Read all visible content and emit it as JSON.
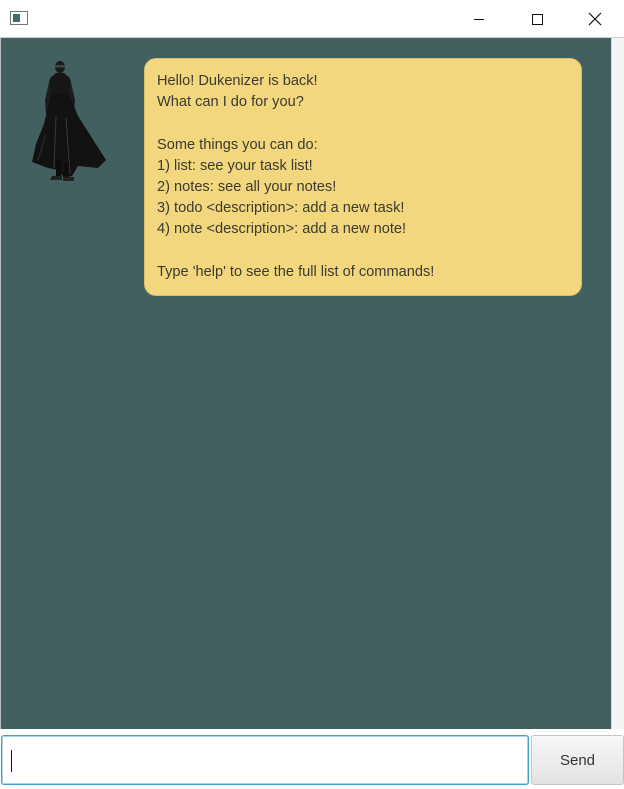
{
  "window": {
    "minimize_icon": "minimize-icon",
    "maximize_icon": "maximize-icon",
    "close_icon": "close-icon"
  },
  "colors": {
    "chat_background": "#426060",
    "bubble": "#f3d77f",
    "input_focus": "#3fa0d9"
  },
  "chat": {
    "bot_avatar": "duke-avatar",
    "bot_message_lines": [
      "Hello! Dukenizer is back!",
      "What can I do for you?",
      "",
      "Some things you can do:",
      "1) list: see your task list!",
      "2) notes: see all your notes!",
      "3) todo <description>: add a new task!",
      "4) note <description>: add a new note!",
      "",
      "Type 'help' to see the full list of commands!"
    ]
  },
  "input": {
    "value": "",
    "send_label": "Send"
  }
}
